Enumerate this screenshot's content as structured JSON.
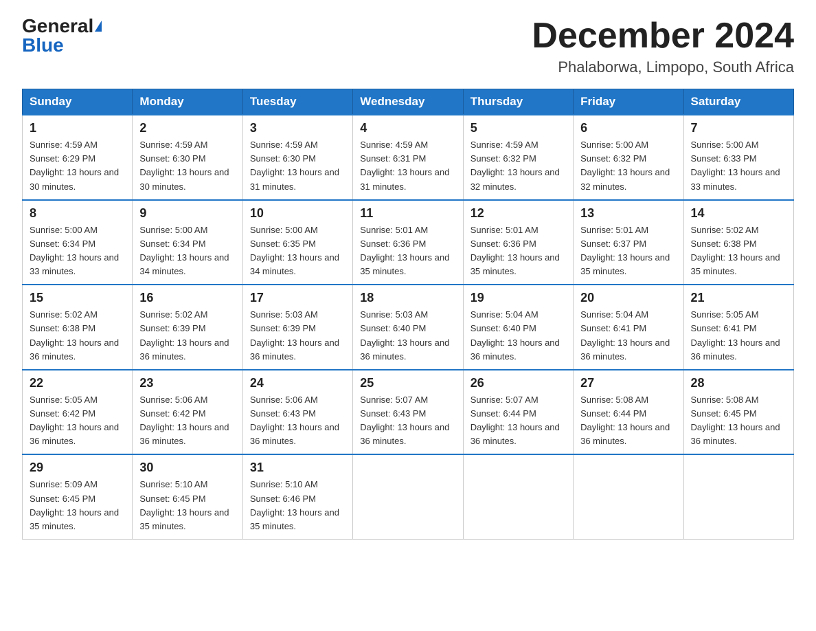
{
  "logo": {
    "general": "General",
    "blue": "Blue"
  },
  "title": {
    "month": "December 2024",
    "location": "Phalaborwa, Limpopo, South Africa"
  },
  "headers": [
    "Sunday",
    "Monday",
    "Tuesday",
    "Wednesday",
    "Thursday",
    "Friday",
    "Saturday"
  ],
  "weeks": [
    [
      {
        "day": "1",
        "sunrise": "4:59 AM",
        "sunset": "6:29 PM",
        "daylight": "13 hours and 30 minutes."
      },
      {
        "day": "2",
        "sunrise": "4:59 AM",
        "sunset": "6:30 PM",
        "daylight": "13 hours and 30 minutes."
      },
      {
        "day": "3",
        "sunrise": "4:59 AM",
        "sunset": "6:30 PM",
        "daylight": "13 hours and 31 minutes."
      },
      {
        "day": "4",
        "sunrise": "4:59 AM",
        "sunset": "6:31 PM",
        "daylight": "13 hours and 31 minutes."
      },
      {
        "day": "5",
        "sunrise": "4:59 AM",
        "sunset": "6:32 PM",
        "daylight": "13 hours and 32 minutes."
      },
      {
        "day": "6",
        "sunrise": "5:00 AM",
        "sunset": "6:32 PM",
        "daylight": "13 hours and 32 minutes."
      },
      {
        "day": "7",
        "sunrise": "5:00 AM",
        "sunset": "6:33 PM",
        "daylight": "13 hours and 33 minutes."
      }
    ],
    [
      {
        "day": "8",
        "sunrise": "5:00 AM",
        "sunset": "6:34 PM",
        "daylight": "13 hours and 33 minutes."
      },
      {
        "day": "9",
        "sunrise": "5:00 AM",
        "sunset": "6:34 PM",
        "daylight": "13 hours and 34 minutes."
      },
      {
        "day": "10",
        "sunrise": "5:00 AM",
        "sunset": "6:35 PM",
        "daylight": "13 hours and 34 minutes."
      },
      {
        "day": "11",
        "sunrise": "5:01 AM",
        "sunset": "6:36 PM",
        "daylight": "13 hours and 35 minutes."
      },
      {
        "day": "12",
        "sunrise": "5:01 AM",
        "sunset": "6:36 PM",
        "daylight": "13 hours and 35 minutes."
      },
      {
        "day": "13",
        "sunrise": "5:01 AM",
        "sunset": "6:37 PM",
        "daylight": "13 hours and 35 minutes."
      },
      {
        "day": "14",
        "sunrise": "5:02 AM",
        "sunset": "6:38 PM",
        "daylight": "13 hours and 35 minutes."
      }
    ],
    [
      {
        "day": "15",
        "sunrise": "5:02 AM",
        "sunset": "6:38 PM",
        "daylight": "13 hours and 36 minutes."
      },
      {
        "day": "16",
        "sunrise": "5:02 AM",
        "sunset": "6:39 PM",
        "daylight": "13 hours and 36 minutes."
      },
      {
        "day": "17",
        "sunrise": "5:03 AM",
        "sunset": "6:39 PM",
        "daylight": "13 hours and 36 minutes."
      },
      {
        "day": "18",
        "sunrise": "5:03 AM",
        "sunset": "6:40 PM",
        "daylight": "13 hours and 36 minutes."
      },
      {
        "day": "19",
        "sunrise": "5:04 AM",
        "sunset": "6:40 PM",
        "daylight": "13 hours and 36 minutes."
      },
      {
        "day": "20",
        "sunrise": "5:04 AM",
        "sunset": "6:41 PM",
        "daylight": "13 hours and 36 minutes."
      },
      {
        "day": "21",
        "sunrise": "5:05 AM",
        "sunset": "6:41 PM",
        "daylight": "13 hours and 36 minutes."
      }
    ],
    [
      {
        "day": "22",
        "sunrise": "5:05 AM",
        "sunset": "6:42 PM",
        "daylight": "13 hours and 36 minutes."
      },
      {
        "day": "23",
        "sunrise": "5:06 AM",
        "sunset": "6:42 PM",
        "daylight": "13 hours and 36 minutes."
      },
      {
        "day": "24",
        "sunrise": "5:06 AM",
        "sunset": "6:43 PM",
        "daylight": "13 hours and 36 minutes."
      },
      {
        "day": "25",
        "sunrise": "5:07 AM",
        "sunset": "6:43 PM",
        "daylight": "13 hours and 36 minutes."
      },
      {
        "day": "26",
        "sunrise": "5:07 AM",
        "sunset": "6:44 PM",
        "daylight": "13 hours and 36 minutes."
      },
      {
        "day": "27",
        "sunrise": "5:08 AM",
        "sunset": "6:44 PM",
        "daylight": "13 hours and 36 minutes."
      },
      {
        "day": "28",
        "sunrise": "5:08 AM",
        "sunset": "6:45 PM",
        "daylight": "13 hours and 36 minutes."
      }
    ],
    [
      {
        "day": "29",
        "sunrise": "5:09 AM",
        "sunset": "6:45 PM",
        "daylight": "13 hours and 35 minutes."
      },
      {
        "day": "30",
        "sunrise": "5:10 AM",
        "sunset": "6:45 PM",
        "daylight": "13 hours and 35 minutes."
      },
      {
        "day": "31",
        "sunrise": "5:10 AM",
        "sunset": "6:46 PM",
        "daylight": "13 hours and 35 minutes."
      },
      null,
      null,
      null,
      null
    ]
  ]
}
